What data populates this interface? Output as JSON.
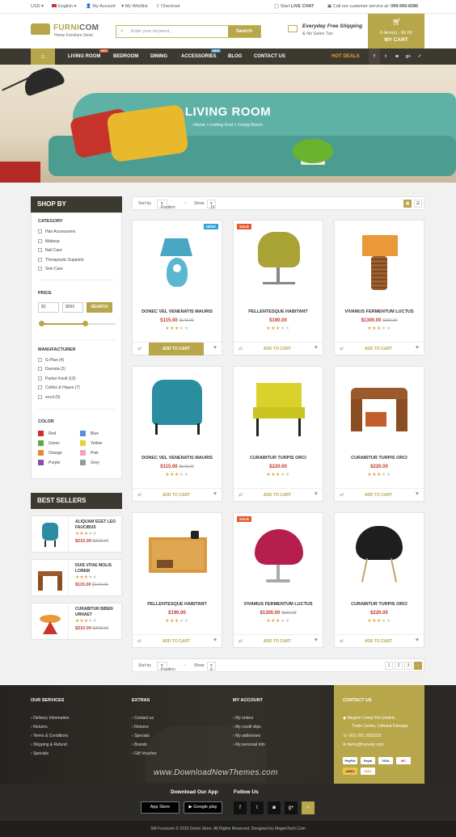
{
  "topbar": {
    "currency": "USD",
    "language": "English",
    "my_account": "My Account",
    "wishlist": "My Wishlist",
    "checkout": "Checkout",
    "live_chat_pre": "Start",
    "live_chat": "LIVE CHAT",
    "service_pre": "Call our customer service at:",
    "service_phone": "099-999-8386"
  },
  "header": {
    "logo_a": "FURNI",
    "logo_b": "COM",
    "logo_sub": "Home Furniture Store",
    "search_placeholder": "Enter your keyword...",
    "search_button": "Search",
    "ship_title": "Everyday Free Shipping",
    "ship_sub": "& No Sales Tax",
    "cart_summary": "0 item(s) - $0.00",
    "cart_label": "MY CART"
  },
  "nav": {
    "items": [
      "LIVING ROOM",
      "BEDROOM",
      "DINING",
      "ACCESSORIES",
      "BLOG",
      "CONTACT US"
    ],
    "hot_badge": "HOT",
    "new_badge": "NEW",
    "hot_deals": "HOT DEALS",
    "social": [
      "f",
      "t",
      "◙",
      "g+",
      "✓"
    ]
  },
  "hero": {
    "title": "LIVING ROOM",
    "breadcrumb": [
      "Home",
      "Listing Grid",
      "Living Room"
    ]
  },
  "sidebar": {
    "title": "SHOP BY",
    "category_title": "CATEGORY",
    "categories": [
      "Hair Accessories",
      "Makeup",
      "Nail Care",
      "Therapeutic Supports",
      "Skin Care"
    ],
    "price_title": "PRICE",
    "price_min": "$0",
    "price_max": "$999",
    "price_button": "SEARCH",
    "manufacturer_title": "MANUFACTURER",
    "manufacturers": [
      "G-Plan (4)",
      "Duresta (2)",
      "Parker Knoll (10)",
      "Collins & Hayes (7)",
      "ercol (0)"
    ],
    "color_title": "COLOR",
    "colors": [
      {
        "name": "Red",
        "hex": "#d62c2c"
      },
      {
        "name": "Blue",
        "hex": "#5b8fd6"
      },
      {
        "name": "Green",
        "hex": "#5fa64a"
      },
      {
        "name": "Yellow",
        "hex": "#e6d230"
      },
      {
        "name": "Orange",
        "hex": "#e58a2e"
      },
      {
        "name": "Pink",
        "hex": "#f0a6b6"
      },
      {
        "name": "Purple",
        "hex": "#8a4fa8"
      },
      {
        "name": "Grey",
        "hex": "#9a9a9a"
      }
    ]
  },
  "best_sellers": {
    "title": "BEST SELLERS",
    "items": [
      {
        "name": "ALIQUAM EGET LEO FAUCIBUS",
        "price": "$210.00",
        "old": "$315.00",
        "rating": 3
      },
      {
        "name": "DUIS VITAE MOLIS LOREM",
        "price": "$115.00",
        "old": "$142.00",
        "rating": 3
      },
      {
        "name": "CURABITUR BIBEN URNAET",
        "price": "$210.00",
        "old": "$315.00",
        "rating": 3
      }
    ]
  },
  "toolbar": {
    "sort_label": "Sort by",
    "sort_value": "Position",
    "show_label": "Show",
    "show_value_top": "15",
    "show_value_bottom": "9",
    "pages": [
      "1",
      "2",
      "3",
      "›"
    ]
  },
  "products": [
    {
      "name": "DONEC VEL VENENATIS MAURIS",
      "price": "$115.00",
      "old": "$142.00",
      "rating": 3,
      "tag": "NEW!",
      "tag_color": "#2ea3dc",
      "img": "lamp-blue",
      "active": true
    },
    {
      "name": "PELLENTESQUE HABITANT",
      "price": "$190.00",
      "old": "",
      "rating": 3,
      "tag": "SALE",
      "tag_color": "#e3592b",
      "img": "chair-green",
      "active": false
    },
    {
      "name": "VIVAMUS FERMENTUM LUCTUS",
      "price": "$1300.00",
      "old": "$150.00",
      "rating": 3,
      "tag": "",
      "tag_color": "",
      "img": "lamp-orange",
      "active": false
    },
    {
      "name": "DONEC VEL VENENATIS MAURIS",
      "price": "$115.00",
      "old": "$142.00",
      "rating": 3,
      "tag": "",
      "tag_color": "",
      "img": "armchair-teal",
      "active": false
    },
    {
      "name": "CURABITUR TURPIS ORCI",
      "price": "$220.00",
      "old": "",
      "rating": 3,
      "tag": "",
      "tag_color": "",
      "img": "chair-yellow",
      "active": false
    },
    {
      "name": "CURABITUR TURPIS ORCI",
      "price": "$220.00",
      "old": "",
      "rating": 3,
      "tag": "",
      "tag_color": "",
      "img": "table-wood",
      "active": false
    },
    {
      "name": "PELLENTESQUE HABITANT",
      "price": "$190.00",
      "old": "",
      "rating": 3,
      "tag": "",
      "tag_color": "",
      "img": "nightstand",
      "active": false
    },
    {
      "name": "VIVAMUS FERMENTUM LUCTUS",
      "price": "$1300.00",
      "old": "$150.00",
      "rating": 3,
      "tag": "SALE",
      "tag_color": "#e3592b",
      "img": "chair-magenta",
      "active": false
    },
    {
      "name": "CURABITUR TURPIS ORCI",
      "price": "$220.00",
      "old": "",
      "rating": 3,
      "tag": "",
      "tag_color": "",
      "img": "chair-black",
      "active": false
    }
  ],
  "add_to_cart": "ADD TO CART",
  "footer": {
    "services_title": "OUR SERVICES",
    "services": [
      "Delivery Information",
      "Returns",
      "Terms & Conditions",
      "Shipping & Refund",
      "Specials"
    ],
    "extras_title": "EXTRAS",
    "extras": [
      "Contact us",
      "Returns",
      "Specials",
      "Brands",
      "Gift Voucher"
    ],
    "account_title": "MY ACCOUNT",
    "account": [
      "My orders",
      "My credit slips",
      "My addresses",
      "My personal info"
    ],
    "contact_title": "CONTACT US",
    "contact_company": "Megnor Comp Pvt Limited,",
    "contact_address": "Trade Centre, Udhana Darwaja",
    "contact_phone": "(91)-261 3023333",
    "contact_email": "demo@harvest.com",
    "payments": [
      "PayPal",
      "Payal",
      "VISA",
      "MC",
      "AMEX",
      "DISC"
    ],
    "watermark": "www.DownloadNewThemes.com",
    "download_title": "Download Our App",
    "app_store": "App Store",
    "google_play": "Google play",
    "follow_title": "Follow Us",
    "copyright": "SM Furnicom © 2015 Demo Store. All Rights Reserved. Designed by MagenTech.Com"
  }
}
